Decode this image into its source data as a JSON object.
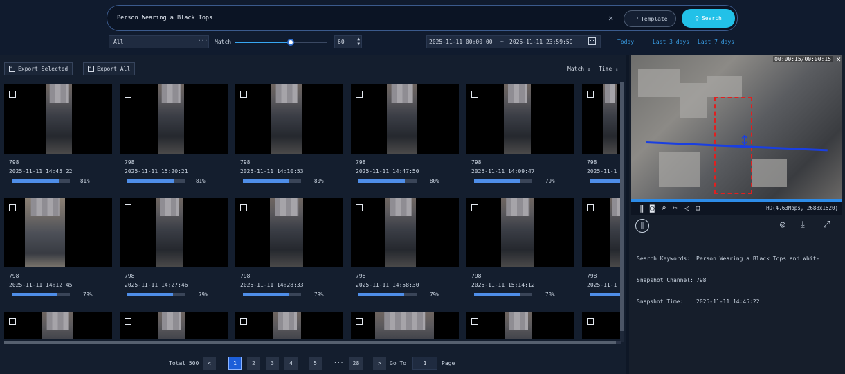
{
  "header": {
    "search_text": "Person Wearing a Black Tops",
    "clear_icon": "close-icon",
    "template_label": "Template",
    "search_label": "Search",
    "channel_select": "All",
    "match_label": "Match",
    "match_value": "60",
    "match_fraction": 0.6,
    "date_start": "2025-11-11 00:00:00",
    "date_sep": "~",
    "date_end": "2025-11-11 23:59:59",
    "quick_today": "Today",
    "quick_3days": "Last 3 days",
    "quick_7days": "Last 7 days",
    "accent_color": "#22c1e8"
  },
  "toolbar": {
    "export_selected": "Export Selected",
    "export_all": "Export All",
    "sort_match": "Match",
    "sort_time": "Time"
  },
  "results": {
    "rows": [
      [
        {
          "channel": "798",
          "time": "2025-11-11 14:45:22",
          "pct": "81%",
          "fill": 0.81
        },
        {
          "channel": "798",
          "time": "2025-11-11 15:20:21",
          "pct": "81%",
          "fill": 0.81
        },
        {
          "channel": "798",
          "time": "2025-11-11 14:10:53",
          "pct": "80%",
          "fill": 0.8
        },
        {
          "channel": "798",
          "time": "2025-11-11 14:47:50",
          "pct": "80%",
          "fill": 0.8
        },
        {
          "channel": "798",
          "time": "2025-11-11 14:09:47",
          "pct": "79%",
          "fill": 0.79
        },
        {
          "channel": "798",
          "time": "2025-11-1",
          "pct": "",
          "fill": 0.79
        }
      ],
      [
        {
          "channel": "798",
          "time": "2025-11-11 14:12:45",
          "pct": "79%",
          "fill": 0.79
        },
        {
          "channel": "798",
          "time": "2025-11-11 14:27:46",
          "pct": "79%",
          "fill": 0.79
        },
        {
          "channel": "798",
          "time": "2025-11-11 14:28:33",
          "pct": "79%",
          "fill": 0.79
        },
        {
          "channel": "798",
          "time": "2025-11-11 14:58:30",
          "pct": "79%",
          "fill": 0.79
        },
        {
          "channel": "798",
          "time": "2025-11-11 15:14:12",
          "pct": "78%",
          "fill": 0.78
        },
        {
          "channel": "798",
          "time": "2025-11-1",
          "pct": "",
          "fill": 0.78
        }
      ]
    ]
  },
  "pagination": {
    "total": "Total 500",
    "pages": [
      "1",
      "2",
      "3",
      "4",
      "5"
    ],
    "ellipsis": "···",
    "last": "28",
    "goto_label": "Go To",
    "goto_value": "1",
    "page_label": "Page"
  },
  "player": {
    "time": "00:00:15/00:00:15",
    "stream_info": "HD(4.63Mbps, 2688x1520)",
    "progress": 1.0
  },
  "details": {
    "keywords_label": "Search Keywords:",
    "keywords_value": "Person Wearing a Black Tops and Whit-",
    "channel_label": "Snapshot Channel:",
    "channel_value": "798",
    "time_label": "Snapshot Time:",
    "time_value": "2025-11-11 14:45:22"
  }
}
